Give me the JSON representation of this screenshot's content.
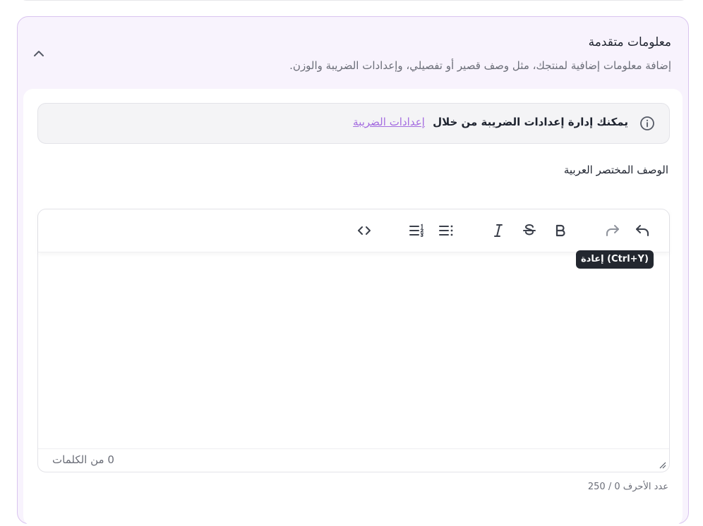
{
  "section": {
    "title": "معلومات متقدمة",
    "subtitle": "إضافة معلومات إضافية لمنتجك، مثل وصف قصير أو تفصيلي، وإعدادات الضريبة والوزن."
  },
  "info": {
    "text": "يمكنك إدارة إعدادات الضريبة من خلال",
    "link": "إعدادات الضريبة"
  },
  "field": {
    "label": "الوصف المختصر العربية"
  },
  "editor": {
    "toolbar": {
      "tooltip": "إعادة (Ctrl+Y)",
      "icons": [
        "undo-icon",
        "redo-icon",
        "bold-icon",
        "strikethrough-icon",
        "italic-icon",
        "bullet-list-icon",
        "ordered-list-icon",
        "code-icon"
      ]
    },
    "word_count": "0 من الكلمات"
  },
  "char_count": "عدد الأحرف 0 / 250",
  "colors": {
    "accent": "#a46ce0",
    "section_bg": "#f8f3fd",
    "section_border": "#d9c4ef",
    "tooltip_bg": "#23272f"
  }
}
